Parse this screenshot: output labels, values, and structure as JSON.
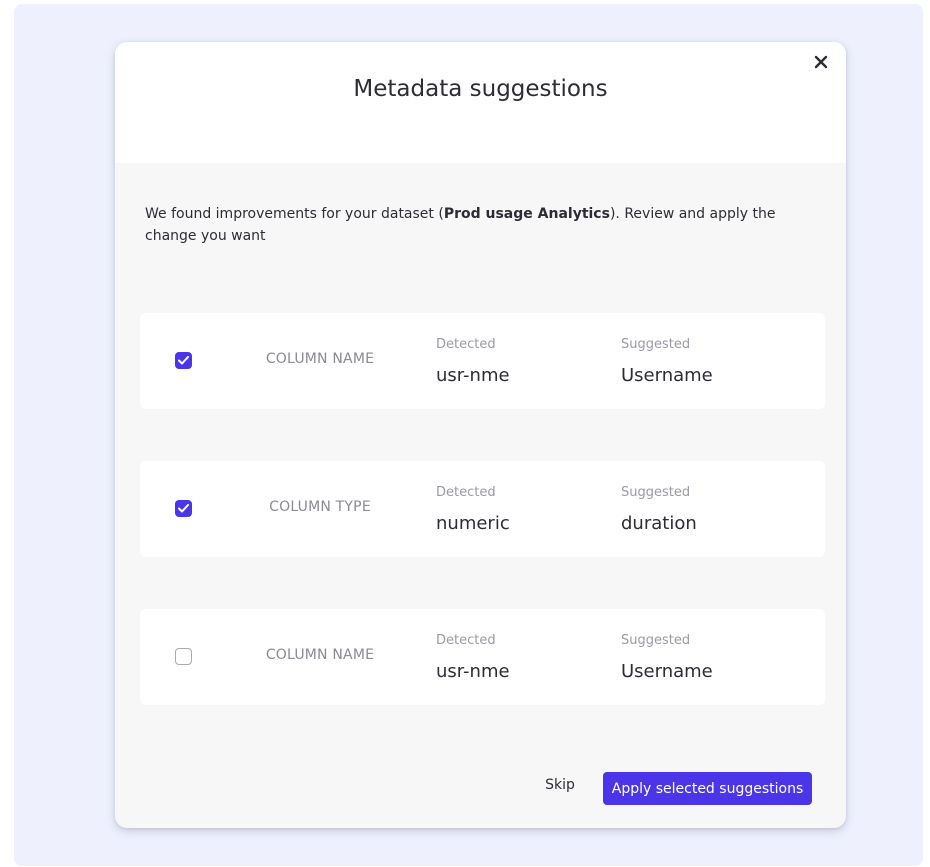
{
  "modal": {
    "title": "Metadata suggestions",
    "close_icon": "close-icon",
    "intro_prefix": "We found improvements for your dataset (",
    "dataset_name": "Prod usage Analytics",
    "intro_suffix": "). Review and apply the change you want"
  },
  "suggestions": [
    {
      "checked": true,
      "type": "COLUMN NAME",
      "detected_label": "Detected",
      "detected_value": "usr-nme",
      "suggested_label": "Suggested",
      "suggested_value": "Username"
    },
    {
      "checked": true,
      "type": "COLUMN TYPE",
      "detected_label": "Detected",
      "detected_value": "numeric",
      "suggested_label": "Suggested",
      "suggested_value": "duration"
    },
    {
      "checked": false,
      "type": "COLUMN NAME",
      "detected_label": "Detected",
      "detected_value": "usr-nme",
      "suggested_label": "Suggested",
      "suggested_value": "Username"
    }
  ],
  "footer": {
    "skip_label": "Skip",
    "apply_label": "Apply selected suggestions"
  },
  "colors": {
    "accent": "#4a36e8",
    "page_background": "#eef1fd",
    "modal_body": "#f7f7f8"
  }
}
